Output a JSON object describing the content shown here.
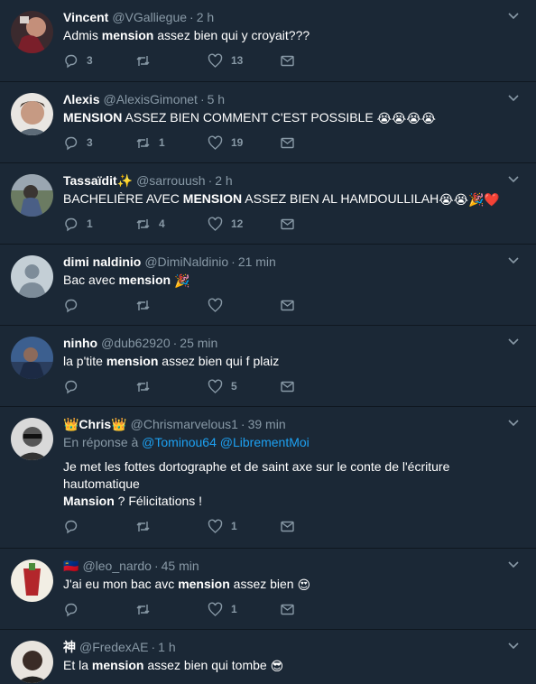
{
  "tweets": [
    {
      "name": "Vincent",
      "handle": "@VGalliegue",
      "time": "2 h",
      "text_before": "Admis ",
      "text_bold": "mension",
      "text_after": " assez bien qui y croyait???",
      "emojis": "",
      "replies": "3",
      "retweets": "",
      "likes": "13"
    },
    {
      "name": "Λlexis",
      "handle": "@AlexisGimonet",
      "time": "5 h",
      "text_before": "",
      "text_bold": "MENSION",
      "text_after": " ASSEZ BIEN COMMENT C'EST POSSIBLE ",
      "emojis": "😭😭😭😭",
      "replies": "3",
      "retweets": "1",
      "likes": "19"
    },
    {
      "name": "Tassaïdit✨",
      "handle": "@sarrouush",
      "time": "2 h",
      "text_before": "BACHELIÈRE AVEC ",
      "text_bold": "MENSION",
      "text_after": " ASSEZ BIEN AL HAMDOULLILAH",
      "emojis": "😭😭🎉❤️",
      "replies": "1",
      "retweets": "4",
      "likes": "12"
    },
    {
      "name": "dimi naldinio",
      "handle": "@DimiNaldinio",
      "time": "21 min",
      "text_before": "Bac avec ",
      "text_bold": "mension",
      "text_after": " ",
      "emojis": "🎉",
      "replies": "",
      "retweets": "",
      "likes": ""
    },
    {
      "name": "ninho",
      "handle": "@dub62920",
      "time": "25 min",
      "text_before": "la p'tite ",
      "text_bold": "mension",
      "text_after": " assez bien qui f plaiz",
      "emojis": "",
      "replies": "",
      "retweets": "",
      "likes": "5"
    }
  ],
  "chris": {
    "name": "👑Chris👑",
    "handle": "@Chrismarvelous1",
    "time": "39 min",
    "reply_prefix": "En réponse à ",
    "mention1": "@Tominou64",
    "mention2": "@LibrementMoi",
    "line1": "Je met les fottes dortographe et de saint axe sur le conte de l'écriture",
    "line2": "hautomatique",
    "bold3": "Mansion",
    "line3": " ?  Félicitations !",
    "replies": "",
    "retweets": "",
    "likes": "1"
  },
  "leo": {
    "flag": "🇱🇮",
    "handle": "@leo_nardo",
    "time": "45 min",
    "text_before": "J'ai eu mon bac avc ",
    "text_bold": "mension",
    "text_after": " assez bien ",
    "emojis": "😍",
    "replies": "",
    "retweets": "",
    "likes": "1"
  },
  "fredex": {
    "name": "神",
    "handle": "@FredexAE",
    "time": "1 h",
    "text_before": "Et la ",
    "text_bold": "mension",
    "text_after": " assez bien qui tombe ",
    "emojis": "😎"
  },
  "sep": "·",
  "colors": {
    "background": "#1b2836",
    "muted": "#8899a6",
    "link": "#1da1f2",
    "separator": "#0f1720"
  }
}
